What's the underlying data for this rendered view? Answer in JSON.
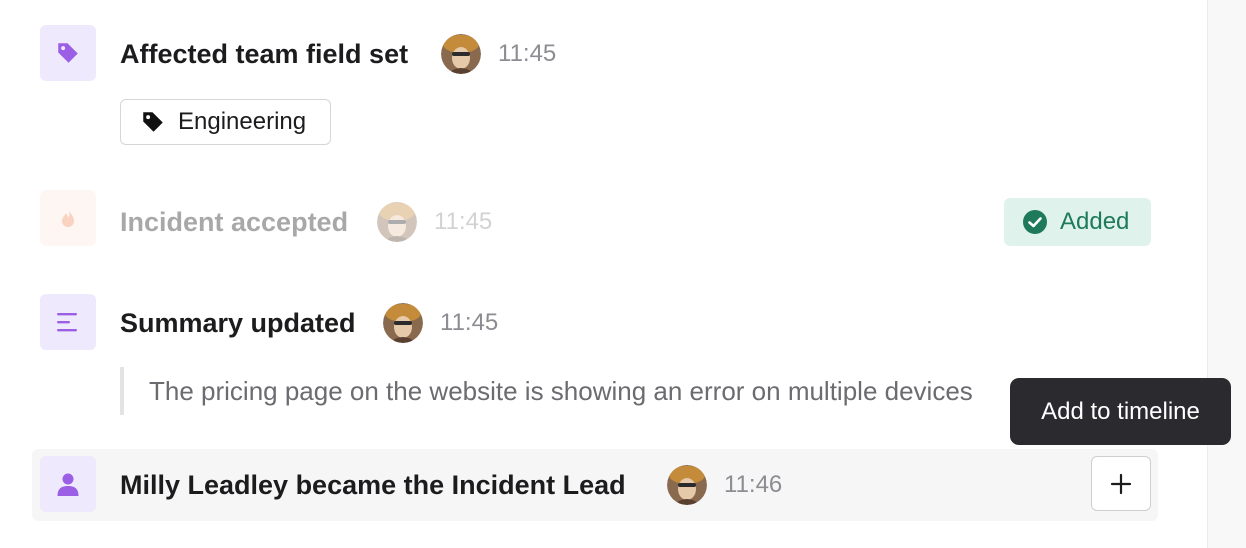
{
  "events": [
    {
      "title": "Affected team field set",
      "time": "11:45",
      "icon": "tag-icon"
    },
    {
      "title": "Incident accepted",
      "time": "11:45",
      "icon": "flame-icon"
    },
    {
      "title": "Summary updated",
      "time": "11:45",
      "icon": "text-lines-icon"
    },
    {
      "title": "Milly Leadley became the Incident Lead",
      "time": "11:46",
      "icon": "user-icon"
    }
  ],
  "tag": {
    "label": "Engineering",
    "icon": "tag-icon"
  },
  "badge": {
    "label": "Added",
    "icon": "check-circle-icon"
  },
  "summary_text": "The pricing page on the website is showing an error on multiple devices",
  "tooltip": "Add to timeline",
  "colors": {
    "purple_bg": "#efe9fd",
    "purple_icon": "#9b5fe6",
    "orange_bg": "#fde9e2",
    "orange_icon": "#f08a5d",
    "badge_bg": "#dff3ec",
    "badge_text": "#1f7a5c",
    "tooltip_bg": "#2b2b2f"
  }
}
